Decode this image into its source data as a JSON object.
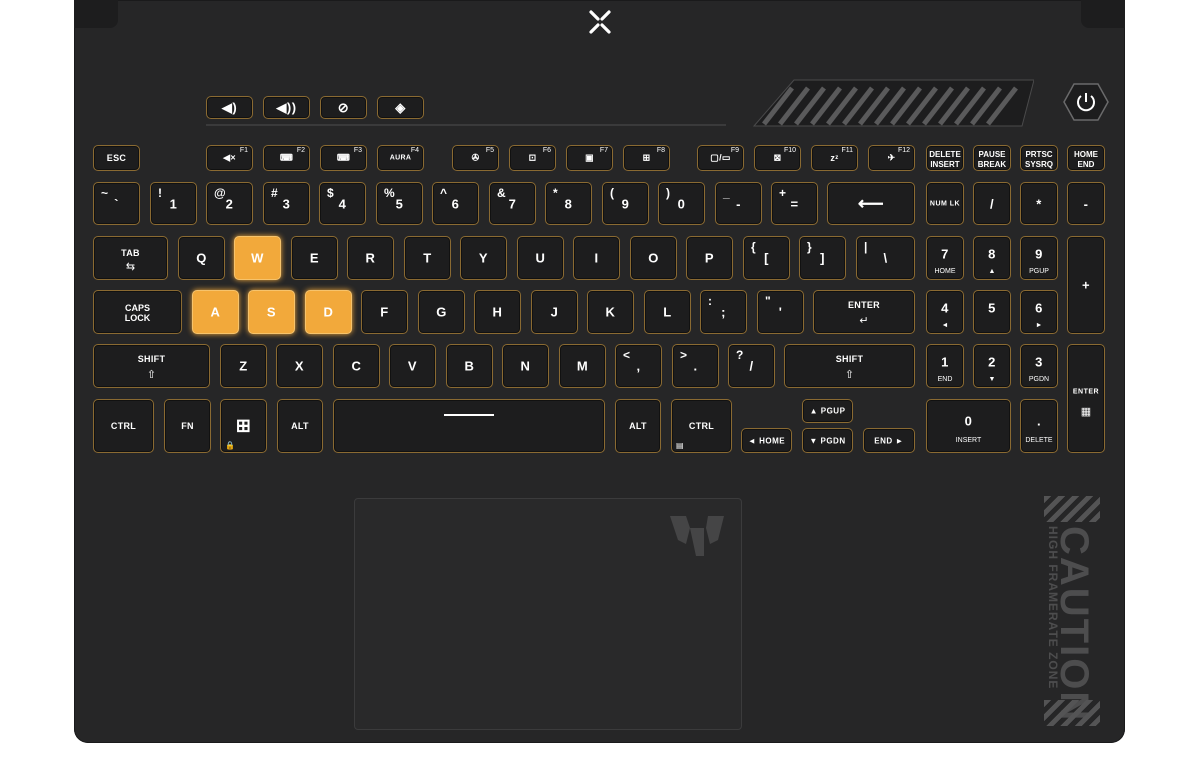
{
  "keys": {
    "esc": "ESC",
    "f1": "F1",
    "f2": "F2",
    "f3": "F3",
    "f4": "F4",
    "f4_aura": "AURA",
    "f5": "F5",
    "f6": "F6",
    "f7": "F7",
    "f8": "F8",
    "f9": "F9",
    "f10": "F10",
    "f11": "F11",
    "f12": "F12",
    "delete_top": "DELETE",
    "insert_bot": "INSERT",
    "pause_top": "PAUSE",
    "break_bot": "BREAK",
    "prtsc_top": "PRTSC",
    "sysrq_bot": "SYSRQ",
    "home_top": "HOME",
    "end_bot": "END",
    "row1": [
      {
        "top": "~",
        "main": "`"
      },
      {
        "top": "!",
        "main": "1"
      },
      {
        "top": "@",
        "main": "2"
      },
      {
        "top": "#",
        "main": "3"
      },
      {
        "top": "$",
        "main": "4"
      },
      {
        "top": "%",
        "main": "5"
      },
      {
        "top": "^",
        "main": "6"
      },
      {
        "top": "&",
        "main": "7"
      },
      {
        "top": "*",
        "main": "8"
      },
      {
        "top": "(",
        "main": "9"
      },
      {
        "top": ")",
        "main": "0"
      },
      {
        "top": "_",
        "main": "-"
      },
      {
        "top": "+",
        "main": "="
      }
    ],
    "backspace": "⟵",
    "numlk": "NUM LK",
    "np_slash": "/",
    "np_star": "*",
    "np_minus": "-",
    "tab": "TAB",
    "row2": [
      "Q",
      "W",
      "E",
      "R",
      "T",
      "Y",
      "U",
      "I",
      "O",
      "P"
    ],
    "lbrace_top": "{",
    "lbrace": "[",
    "rbrace_top": "}",
    "rbrace": "]",
    "pipe_top": "|",
    "backslash": "\\",
    "np7": "7",
    "np7_sub": "HOME",
    "np8": "8",
    "np8_sub": "▲",
    "np9": "9",
    "np9_sub": "PGUP",
    "np_plus": "+",
    "caps1": "CAPS",
    "caps2": "LOCK",
    "row3": [
      "A",
      "S",
      "D",
      "F",
      "G",
      "H",
      "J",
      "K",
      "L"
    ],
    "semi_top": ":",
    "semi": ";",
    "quote_top": "\"",
    "quote": "'",
    "enter": "ENTER",
    "np4": "4",
    "np4_sub": "◄",
    "np5": "5",
    "np6": "6",
    "np6_sub": "►",
    "shift": "SHIFT",
    "row4": [
      "Z",
      "X",
      "C",
      "V",
      "B",
      "N",
      "M"
    ],
    "comma_top": "<",
    "comma": ",",
    "period_top": ">",
    "period": ".",
    "slash_top": "?",
    "slash": "/",
    "np1": "1",
    "np1_sub": "END",
    "np2": "2",
    "np2_sub": "▼",
    "np3": "3",
    "np3_sub": "PGDN",
    "np_enter": "ENTER",
    "ctrl": "CTRL",
    "fn": "FN",
    "alt": "ALT",
    "pgup": "▲ PGUP",
    "home": "◄ HOME",
    "pgdn": "▼ PGDN",
    "end": "END ►",
    "np0": "0",
    "np0_sub": "INSERT",
    "np_dot": ".",
    "np_dot_sub": "DELETE"
  },
  "decals": {
    "caution_big": "CAUTION",
    "caution_small": "HIGH FRAMERATE ZONE"
  },
  "colors": {
    "deck": "#262627",
    "key_border": "#8a6a32",
    "wasd_highlight": "#f2a93b"
  },
  "icons": [
    "volume-down-icon",
    "volume-up-icon",
    "mic-mute-icon",
    "armoury-crate-icon",
    "power-icon",
    "windows-icon",
    "lock-icon",
    "calculator-icon"
  ]
}
